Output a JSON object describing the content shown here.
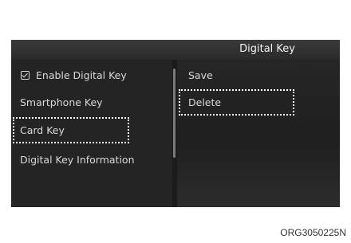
{
  "screen": {
    "title": "Digital Key",
    "left_menu": [
      {
        "label": "Enable Digital Key",
        "checked": true
      },
      {
        "label": "Smartphone Key"
      },
      {
        "label": "Card Key",
        "highlighted": true
      },
      {
        "label": "Digital Key Information"
      }
    ],
    "right_menu": [
      {
        "label": "Save"
      },
      {
        "label": "Delete",
        "highlighted": true
      }
    ]
  },
  "caption": "ORG3050225N"
}
